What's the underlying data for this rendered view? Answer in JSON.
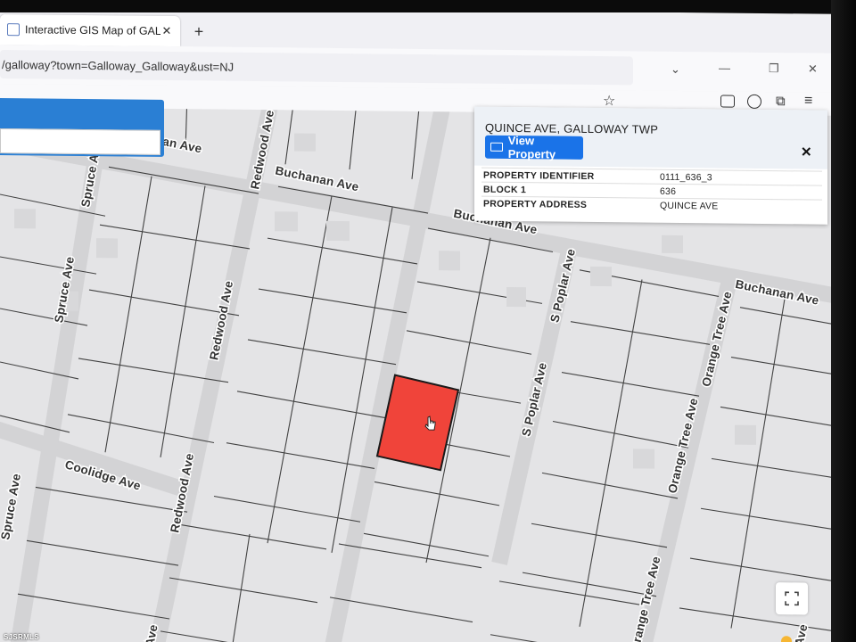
{
  "browser": {
    "tab_title": "Interactive GIS Map of GALLOW",
    "tab_close": "✕",
    "new_tab": "+",
    "url": "/galloway?town=Galloway_Galloway&ust=NJ",
    "tabs_list_icon": "chevron-down-icon",
    "window_controls": [
      "—",
      "❐",
      "✕"
    ]
  },
  "map": {
    "streets": [
      "Buchanan Ave",
      "Buchanan Ave",
      "Buchanan Ave",
      "Buchanan Ave",
      "Redwood Ave",
      "Redwood Ave",
      "Redwood Ave",
      "Spruce Ave",
      "Spruce Ave",
      "Spruce Ave",
      "S Poplar Ave",
      "S Poplar Ave",
      "Orange Tree Ave",
      "Orange Tree Ave",
      "Orange Tree Ave",
      "Coolidge Ave",
      "Ave",
      "Ave"
    ],
    "selected_parcel_color": "#f0443a",
    "parcel_fill": "#e4e4e6",
    "road_color": "#d6d6d8",
    "building_color": "#d9d9db"
  },
  "popup": {
    "title": "QUINCE AVE, GALLOWAY TWP",
    "view_button": "View Property",
    "close": "✕",
    "rows": [
      {
        "key": "PROPERTY IDENTIFIER",
        "value": "0111_636_3"
      },
      {
        "key": "BLOCK 1",
        "value": "636"
      },
      {
        "key": "PROPERTY ADDRESS",
        "value": "QUINCE AVE"
      }
    ]
  },
  "watermark": "SJSRMLS",
  "accent": "#1a73e8"
}
